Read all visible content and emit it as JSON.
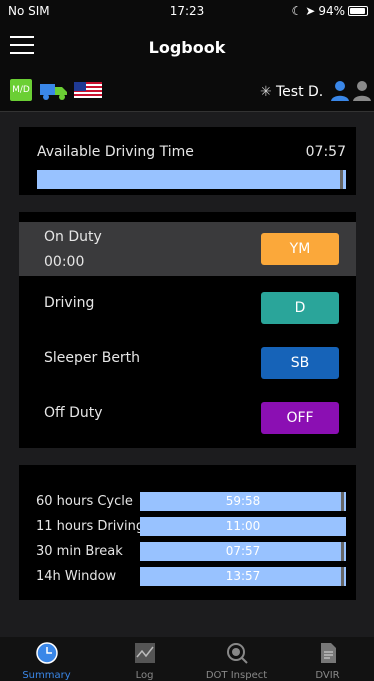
{
  "status_bar": {
    "carrier": "No SIM",
    "time": "17:23",
    "battery": "94%"
  },
  "nav": {
    "title": "Logbook"
  },
  "info": {
    "md_label": "M/D",
    "driver_name": "Test D."
  },
  "available_driving": {
    "label": "Available Driving Time",
    "value": "07:57",
    "progress": 0.99
  },
  "statuses": [
    {
      "label": "On Duty",
      "timer": "00:00",
      "button": "YM",
      "color": "#fba83a",
      "active": true
    },
    {
      "label": "Driving",
      "button": "D",
      "color": "#2aa59a"
    },
    {
      "label": "Sleeper Berth",
      "button": "SB",
      "color": "#1663b8"
    },
    {
      "label": "Off Duty",
      "button": "OFF",
      "color": "#8b0fb3"
    }
  ],
  "cycles": [
    {
      "label": "60 hours Cycle",
      "value": "59:58",
      "progress": 0.99
    },
    {
      "label": "11 hours Driving",
      "value": "11:00",
      "progress": 1.0
    },
    {
      "label": "30 min Break",
      "value": "07:57",
      "progress": 0.99
    },
    {
      "label": "14h Window",
      "value": "13:57",
      "progress": 0.99
    }
  ],
  "tabs": [
    {
      "label": "Summary",
      "icon": "clock-icon",
      "active": true
    },
    {
      "label": "Log",
      "icon": "log-chart-icon"
    },
    {
      "label": "DOT Inspect",
      "icon": "inspect-icon"
    },
    {
      "label": "DVIR",
      "icon": "document-icon"
    }
  ],
  "colors": {
    "accent": "#3a87e8",
    "bar": "#98c2ff",
    "md_badge": "#6bcf34"
  }
}
